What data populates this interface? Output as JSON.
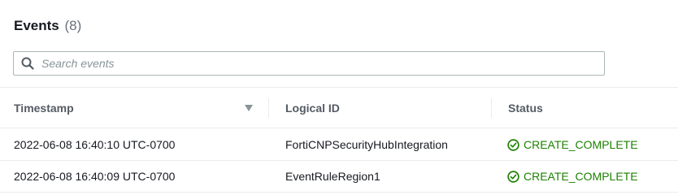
{
  "panel": {
    "title": "Events",
    "count": "(8)"
  },
  "search": {
    "placeholder": "Search events",
    "value": ""
  },
  "columns": [
    {
      "label": "Timestamp",
      "sorted": "descending"
    },
    {
      "label": "Logical ID"
    },
    {
      "label": "Status"
    }
  ],
  "rows": [
    {
      "timestamp": "2022-06-08 16:40:10 UTC-0700",
      "logical_id": "FortiCNPSecurityHubIntegration",
      "status": "CREATE_COMPLETE"
    },
    {
      "timestamp": "2022-06-08 16:40:09 UTC-0700",
      "logical_id": "EventRuleRegion1",
      "status": "CREATE_COMPLETE"
    }
  ],
  "colors": {
    "success": "#1d8102",
    "header_text": "#545b64",
    "border": "#eaeded"
  },
  "icons": {
    "search": "search-icon",
    "sort": "caret-down-icon",
    "status": "check-circle-icon"
  }
}
